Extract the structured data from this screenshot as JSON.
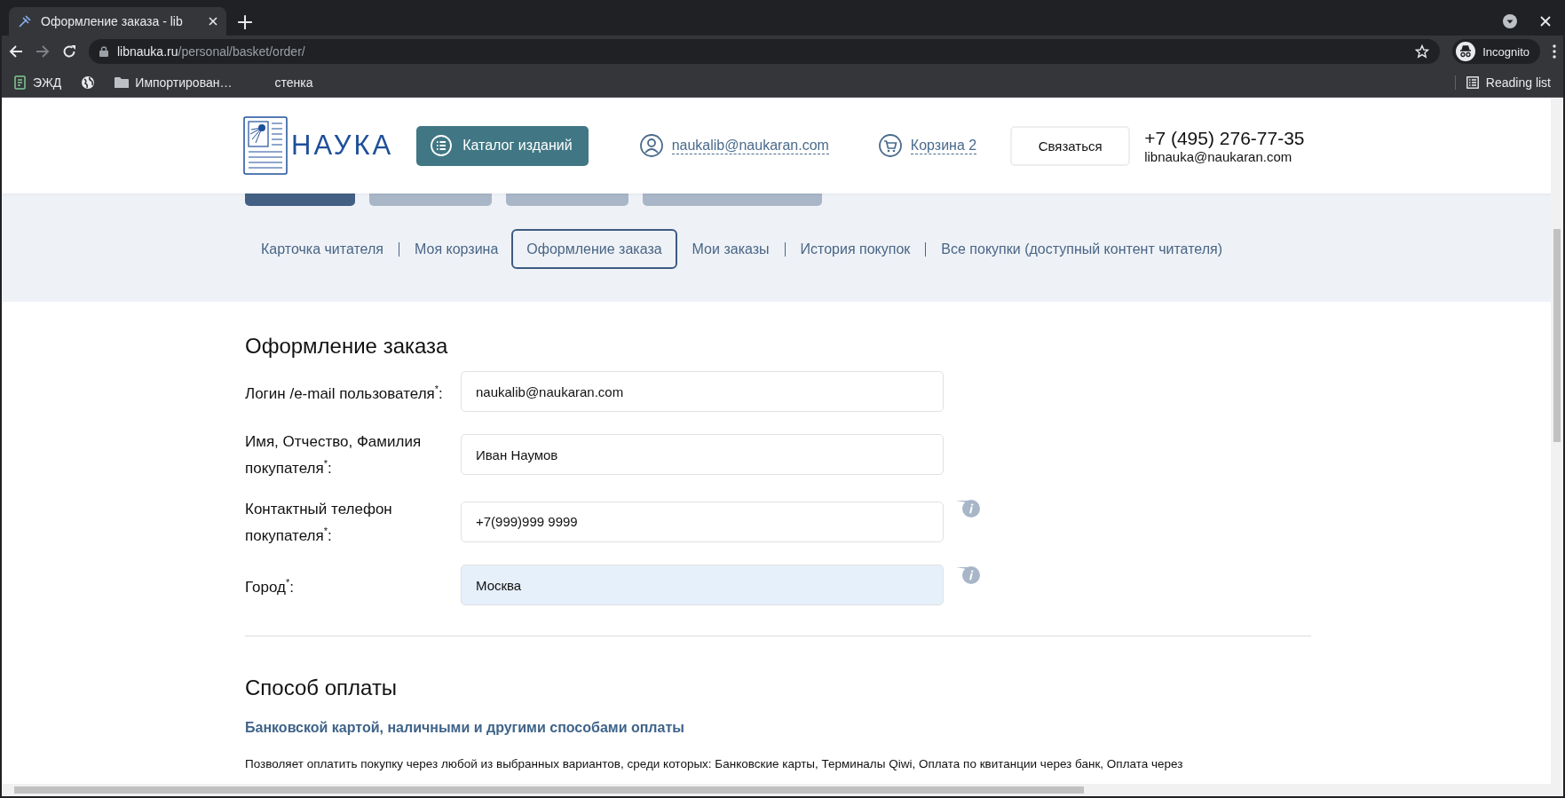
{
  "browser": {
    "tab": {
      "title": "Оформление заказа - lib"
    },
    "address": {
      "domain": "libnauka.ru",
      "path": "/personal/basket/order/"
    },
    "profile": "Incognito",
    "bookmarks": [
      {
        "kind": "app",
        "label": "ЭЖД"
      },
      {
        "kind": "globe"
      },
      {
        "kind": "folder",
        "label": "Импортирован…"
      },
      {
        "kind": "plain",
        "label": "стенка"
      }
    ],
    "reading_list": "Reading list"
  },
  "header": {
    "logo": "НАУКА",
    "catalog_button": "Каталог изданий",
    "account": "naukalib@naukaran.com",
    "cart": "Корзина 2",
    "contact_button": "Связаться",
    "phone": "+7 (495) 276-77-35",
    "email": "libnauka@naukaran.com"
  },
  "top_pills": [
    {
      "selected": true
    },
    {
      "selected": false
    },
    {
      "selected": false
    },
    {
      "selected": false
    }
  ],
  "nav": [
    {
      "label": "Карточка читателя",
      "selected": false
    },
    {
      "label": "Моя корзина",
      "selected": false
    },
    {
      "label": "Оформление заказа",
      "selected": true
    },
    {
      "label": "Мои заказы",
      "selected": false
    },
    {
      "label": "История покупок",
      "selected": false
    },
    {
      "label": "Все покупки (доступный контент читателя)",
      "selected": false
    }
  ],
  "form": {
    "title": "Оформление заказа",
    "fields": [
      {
        "label": "Логин /e-mail пользователя$^{*}$:",
        "value": "naukalib@naukaran.com",
        "info": false,
        "autofilled": false
      },
      {
        "label": "Имя, Отчество, Фамилия покупателя$^{*}$:",
        "value": "Иван Наумов",
        "info": false,
        "autofilled": false
      },
      {
        "label": "Контактный телефон покупателя$^{*}$:",
        "value": "+7(999)999 9999",
        "info": true,
        "autofilled": false
      },
      {
        "label": "Город$^{*}$:",
        "value": "Москва",
        "info": true,
        "autofilled": true
      }
    ]
  },
  "payment": {
    "title": "Способ оплаты",
    "option": "Банковской картой, наличными и другими способами оплаты",
    "description": "Позволяет оплатить покупку через любой из выбранных вариантов, среди которых: Банковские карты, Терминалы Qiwi, Оплата по квитанции через банк, Оплата через"
  }
}
